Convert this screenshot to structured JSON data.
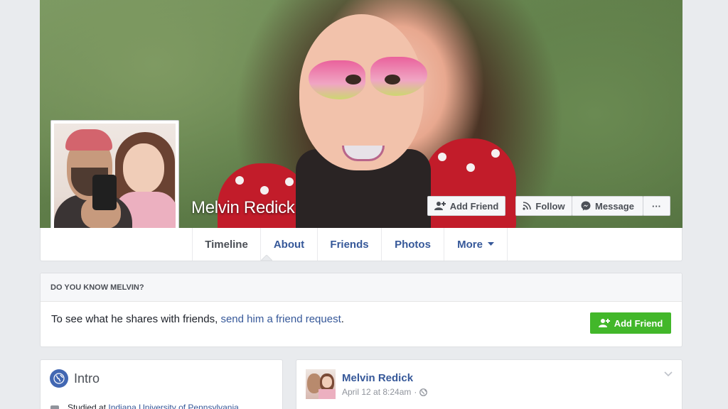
{
  "profile": {
    "name": "Melvin Redick"
  },
  "cover_actions": {
    "add_friend": "Add Friend",
    "follow": "Follow",
    "message": "Message",
    "more": "···"
  },
  "tabs": [
    {
      "label": "Timeline"
    },
    {
      "label": "About"
    },
    {
      "label": "Friends"
    },
    {
      "label": "Photos"
    },
    {
      "label": "More"
    }
  ],
  "know_card": {
    "heading": "DO YOU KNOW MELVIN?",
    "text_before": "To see what he shares with friends, ",
    "link_text": "send him a friend request",
    "text_after": ".",
    "button_label": "Add Friend"
  },
  "intro": {
    "title": "Intro",
    "studied_prefix": "Studied at ",
    "studied_link": "Indiana University of Pennsylvania"
  },
  "post": {
    "author": "Melvin Redick",
    "timestamp": "April 12 at 8:24am",
    "separator": "·"
  },
  "colors": {
    "link": "#365899",
    "green": "#42b72a",
    "background": "#e9ebee"
  }
}
